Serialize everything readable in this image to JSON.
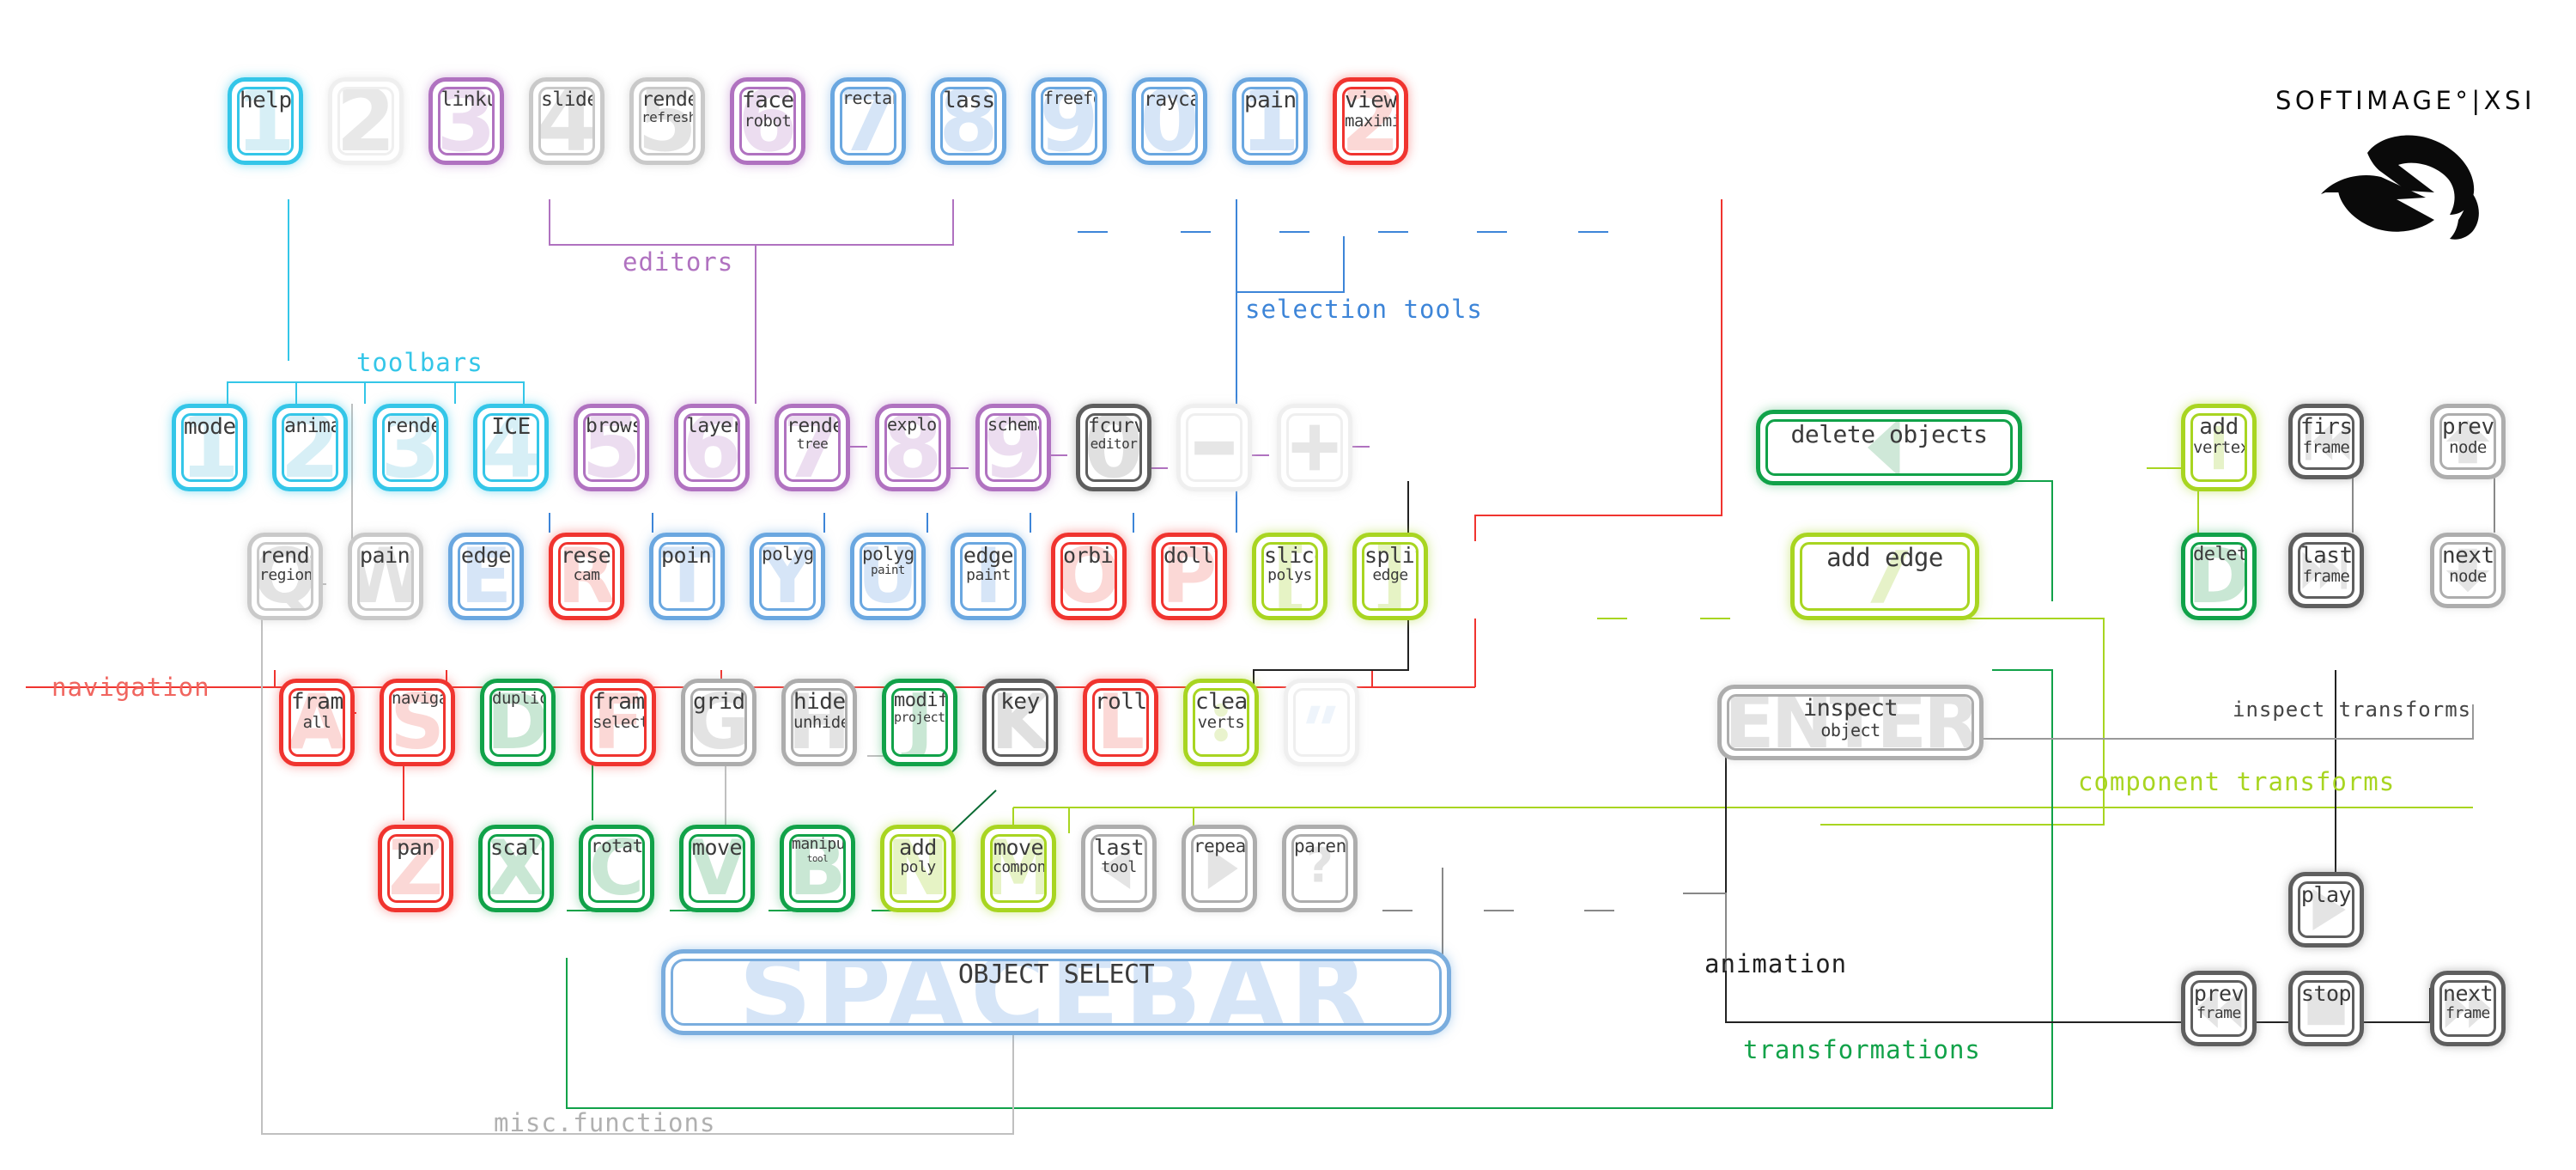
{
  "brand": {
    "wordmark": "SOFTIMAGE°|XSI",
    "logo_icon": "softimage-bird-logo"
  },
  "categories": [
    {
      "name": "toolbars",
      "label": "toolbars",
      "color": "#34c6e8"
    },
    {
      "name": "editors",
      "label": "editors",
      "color": "#b072c0"
    },
    {
      "name": "selection-tools",
      "label": "selection tools",
      "color": "#3d85d8"
    },
    {
      "name": "navigation",
      "label": "navigation",
      "color": "#f0655f"
    },
    {
      "name": "inspect-transforms",
      "label": "inspect transforms",
      "color": "#444444"
    },
    {
      "name": "component-transforms",
      "label": "component transforms",
      "color": "#a8d521"
    },
    {
      "name": "misc-functions",
      "label": "misc.functions",
      "color": "#b0b0b0"
    },
    {
      "name": "animation",
      "label": "animation",
      "color": "#222222"
    },
    {
      "name": "transformations",
      "label": "transformations",
      "color": "#11a249"
    }
  ],
  "rows": {
    "number_row": [
      {
        "key": "1",
        "t1": "help",
        "t2": "",
        "color": "cyan"
      },
      {
        "key": "2",
        "t1": "",
        "t2": "",
        "color": "faint"
      },
      {
        "key": "3",
        "t1": "linkup",
        "t2": "",
        "color": "purple"
      },
      {
        "key": "4",
        "t1": "slider",
        "t2": "",
        "color": "grey"
      },
      {
        "key": "5",
        "t1": "render",
        "t2": "refresh",
        "color": "grey"
      },
      {
        "key": "6",
        "t1": "face",
        "t2": "robot",
        "color": "purple"
      },
      {
        "key": "7",
        "t1": "rectangle",
        "t2": "",
        "color": "blue"
      },
      {
        "key": "8",
        "t1": "lasso",
        "t2": "",
        "color": "blue"
      },
      {
        "key": "9",
        "t1": "freeform",
        "t2": "",
        "color": "blue"
      },
      {
        "key": "0",
        "t1": "raycast",
        "t2": "",
        "color": "blue"
      },
      {
        "key": "1",
        "t1": "paint",
        "t2": "",
        "color": "blue"
      },
      {
        "key": "2",
        "t1": "view",
        "t2": "maximize",
        "color": "red"
      }
    ],
    "tab_row": [
      {
        "key": "1",
        "t1": "model",
        "t2": "",
        "color": "cyan"
      },
      {
        "key": "2",
        "t1": "animate",
        "t2": "",
        "color": "cyan"
      },
      {
        "key": "3",
        "t1": "render",
        "t2": "",
        "color": "cyan"
      },
      {
        "key": "4",
        "t1": "ICE",
        "t2": "",
        "color": "cyan"
      },
      {
        "key": "5",
        "t1": "browser",
        "t2": "",
        "color": "purple"
      },
      {
        "key": "6",
        "t1": "layers",
        "t2": "",
        "color": "purple"
      },
      {
        "key": "7",
        "t1": "render",
        "t2": "tree",
        "color": "purple"
      },
      {
        "key": "8",
        "t1": "explorer",
        "t2": "",
        "color": "purple"
      },
      {
        "key": "9",
        "t1": "schematic",
        "t2": "",
        "color": "purple"
      },
      {
        "key": "0",
        "t1": "fcurve",
        "t2": "editor",
        "color": "dgrey"
      },
      {
        "key": "-",
        "t1": "",
        "t2": "",
        "color": "faint"
      },
      {
        "key": "+",
        "t1": "",
        "t2": "",
        "color": "faint"
      }
    ],
    "tab_row_wide": [
      {
        "key": "←",
        "t1": "delete objects",
        "t2": "",
        "color": "green"
      }
    ],
    "q_row": [
      {
        "key": "Q",
        "t1": "render",
        "t2": "region",
        "color": "grey"
      },
      {
        "key": "W",
        "t1": "paint",
        "t2": "",
        "color": "grey"
      },
      {
        "key": "E",
        "t1": "edge",
        "t2": "",
        "color": "blue"
      },
      {
        "key": "R",
        "t1": "reset",
        "t2": "cam",
        "color": "red"
      },
      {
        "key": "T",
        "t1": "point",
        "t2": "",
        "color": "blue"
      },
      {
        "key": "Y",
        "t1": "polygon",
        "t2": "",
        "color": "blue"
      },
      {
        "key": "U",
        "t1": "polygon",
        "t2": "paint",
        "color": "blue"
      },
      {
        "key": "I",
        "t1": "edge",
        "t2": "paint",
        "color": "blue"
      },
      {
        "key": "O",
        "t1": "orbit",
        "t2": "",
        "color": "red"
      },
      {
        "key": "P",
        "t1": "dolly",
        "t2": "",
        "color": "red"
      },
      {
        "key": "[",
        "t1": "slice",
        "t2": "polys",
        "color": "lime"
      },
      {
        "key": "]",
        "t1": "split",
        "t2": "edge",
        "color": "lime"
      }
    ],
    "q_row_wide": [
      {
        "key": "\\",
        "t1": "add edge",
        "t2": "",
        "color": "lime"
      }
    ],
    "a_row": [
      {
        "key": "A",
        "t1": "frame",
        "t2": "all",
        "color": "red"
      },
      {
        "key": "S",
        "t1": "navigate",
        "t2": "",
        "color": "red"
      },
      {
        "key": "D",
        "t1": "duplicate",
        "t2": "",
        "color": "green"
      },
      {
        "key": "F",
        "t1": "frame",
        "t2": "selected",
        "color": "red"
      },
      {
        "key": "G",
        "t1": "grid",
        "t2": "",
        "color": "mgrey"
      },
      {
        "key": "H",
        "t1": "hide",
        "t2": "unhide",
        "color": "mgrey"
      },
      {
        "key": "J",
        "t1": "modify",
        "t2": "projection",
        "color": "green"
      },
      {
        "key": "K",
        "t1": "key",
        "t2": "",
        "color": "dgrey"
      },
      {
        "key": "L",
        "t1": "roll",
        "t2": "",
        "color": "red"
      },
      {
        "key": ";",
        "t1": "clean",
        "t2": "verts",
        "color": "lime"
      },
      {
        "key": "\"",
        "t1": "",
        "t2": "",
        "color": "faint"
      }
    ],
    "a_row_wide": [
      {
        "key": "ENTER",
        "t1": "inspect",
        "t2": "object",
        "color": "mgrey"
      }
    ],
    "z_row": [
      {
        "key": "Z",
        "t1": "pan",
        "t2": "",
        "color": "red"
      },
      {
        "key": "X",
        "t1": "scale",
        "t2": "",
        "color": "green"
      },
      {
        "key": "C",
        "t1": "rotate",
        "t2": "",
        "color": "green"
      },
      {
        "key": "V",
        "t1": "move",
        "t2": "",
        "color": "green"
      },
      {
        "key": "B",
        "t1": "manipulate",
        "t2": "tool",
        "color": "green"
      },
      {
        "key": "N",
        "t1": "add",
        "t2": "poly",
        "color": "lime"
      },
      {
        "key": "M",
        "t1": "move",
        "t2": "component",
        "color": "lime"
      },
      {
        "key": "<",
        "t1": "last",
        "t2": "tool",
        "color": "mgrey"
      },
      {
        "key": ">",
        "t1": "repeat",
        "t2": "",
        "color": "mgrey"
      },
      {
        "key": "?",
        "t1": "parent",
        "t2": "",
        "color": "mgrey"
      }
    ],
    "spacebar": {
      "key": "SPACEBAR",
      "t1": "OBJECT SELECT",
      "t2": "",
      "color": "blue"
    },
    "right_cluster": [
      {
        "key": "add-vertex-icon",
        "t1": "add",
        "t2": "vertex",
        "color": "lime"
      },
      {
        "key": "first-frame-icon",
        "t1": "first",
        "t2": "frame",
        "color": "dgrey"
      },
      {
        "key": "prev-node-icon",
        "t1": "prev",
        "t2": "node",
        "color": "mgrey"
      },
      {
        "key": "D",
        "t1": "delete",
        "t2": "",
        "color": "green"
      },
      {
        "key": "last-frame-icon",
        "t1": "last",
        "t2": "frame",
        "color": "dgrey"
      },
      {
        "key": "next-node-icon",
        "t1": "next",
        "t2": "node",
        "color": "mgrey"
      }
    ],
    "transport": [
      {
        "key": "play-icon",
        "t1": "play",
        "t2": "",
        "color": "dgrey"
      },
      {
        "key": "prev-frame-icon",
        "t1": "prev",
        "t2": "frame",
        "color": "dgrey"
      },
      {
        "key": "stop-icon",
        "t1": "stop",
        "t2": "",
        "color": "dgrey"
      },
      {
        "key": "next-frame-icon",
        "t1": "next",
        "t2": "frame",
        "color": "dgrey"
      }
    ]
  }
}
